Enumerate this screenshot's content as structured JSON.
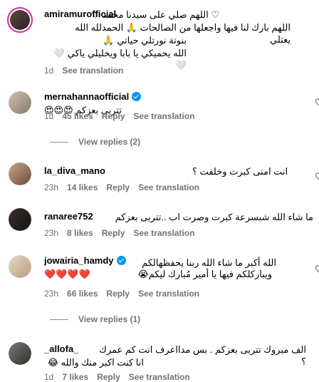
{
  "comments": [
    {
      "username": "amiramurofficial",
      "verified": false,
      "lines": [
        "♡ اللهم صلي على سيدنا محمد ♡",
        "اللهم بارك لنا فيها واجعلها من الصالحات 🙏 الحمدلله الله يعتلي",
        "بنوتة نورتلي حياتي 🙏",
        "الله يحميكي يا بابا ويخليلي ياكي 🤍🤍"
      ],
      "time": "1d",
      "likes": "",
      "reply": "",
      "see_translation": "See translation"
    },
    {
      "username": "mernahannaofficial",
      "verified": true,
      "lines": [
        "تتربى بعزكم 😍😍😍"
      ],
      "time": "1d",
      "likes": "45 likes",
      "reply": "Reply",
      "see_translation": "See translation",
      "view_replies": "View replies (2)"
    },
    {
      "username": "la_diva_mano",
      "verified": false,
      "lines": [
        "انت امتى كبرت وخلفت ؟"
      ],
      "time": "23h",
      "likes": "14 likes",
      "reply": "Reply",
      "see_translation": "See translation"
    },
    {
      "username": "ranaree752",
      "verified": false,
      "lines": [
        "ما شاء الله شبسرعة كبرت وصرت اب ..تتربى بعزكم"
      ],
      "time": "23h",
      "likes": "8 likes",
      "reply": "Reply",
      "see_translation": "See translation"
    },
    {
      "username": "jowairia_hamdy",
      "verified": true,
      "lines": [
        "الله أكبر ما شاء الله ربنا يحفظهالكم",
        "ويباركلكم فيها يا أمير مُبارك ليكم😭",
        "❤️❤️❤️❤️"
      ],
      "time": "23h",
      "likes": "66 likes",
      "reply": "Reply",
      "see_translation": "See translation",
      "view_replies": "View replies (1)"
    },
    {
      "username": "_allofa_",
      "verified": false,
      "lines": [
        "الف مبروك تتربى بعزكم . بس مدااعرف انت كم عمرك ؟",
        "انا كنت اكبر منك والله 😂"
      ],
      "time": "1d",
      "likes": "7 likes",
      "reply": "Reply",
      "see_translation": "See translation"
    }
  ],
  "colors": {
    "meta": "#737373",
    "verified": "#0095f6",
    "story_ring": "#d6249f"
  }
}
